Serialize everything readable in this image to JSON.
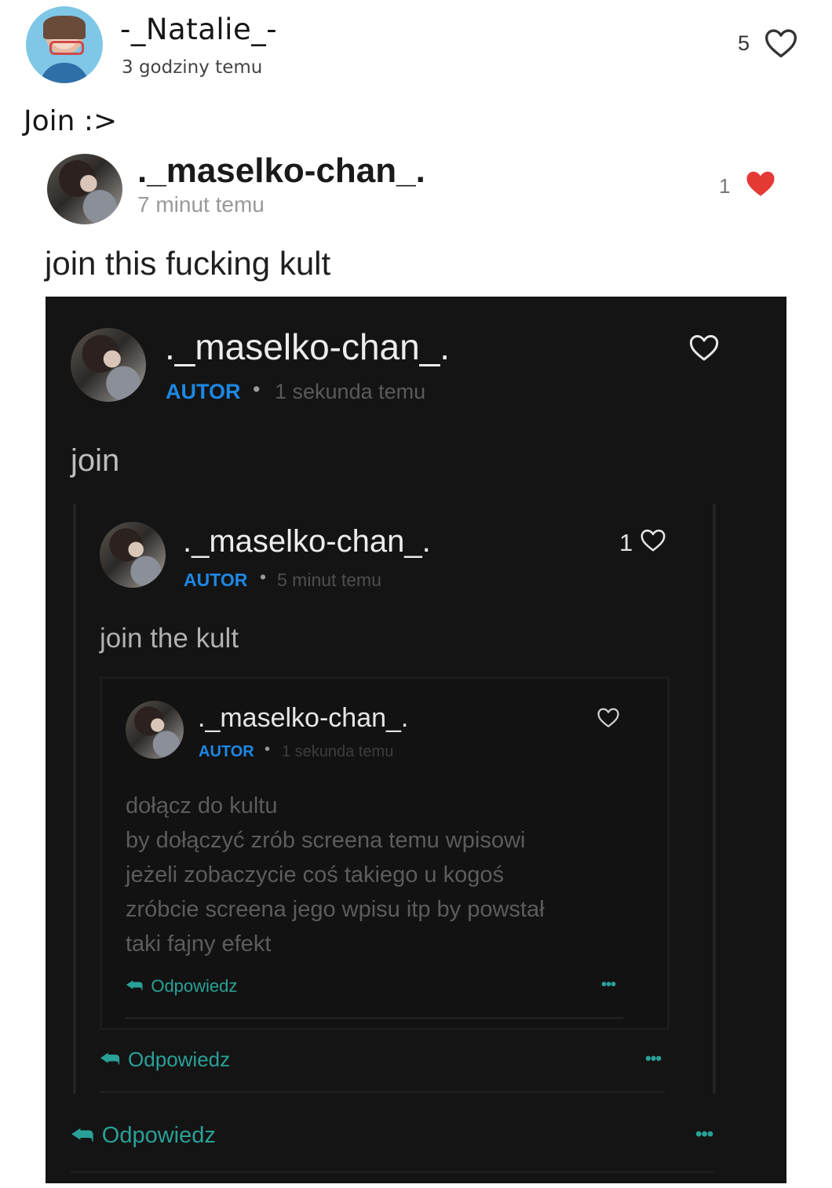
{
  "post": {
    "username": "-_Natalie_-",
    "time": "3 godziny temu",
    "likes": "5",
    "text": "Join :>"
  },
  "reply": {
    "username": "._maselko-chan_.",
    "time": "7 minut temu",
    "likes": "1",
    "text": "join this fucking kult"
  },
  "screenshot": {
    "level1": {
      "username": "._maselko-chan_.",
      "badge": "AUTOR",
      "separator": "•",
      "time": "1 sekunda temu",
      "text": "join",
      "reply_label": "Odpowiedz",
      "more": "•••"
    },
    "level2": {
      "username": "._maselko-chan_.",
      "badge": "AUTOR",
      "separator": "•",
      "time": "5 minut temu",
      "likes": "1",
      "text": "join the kult",
      "reply_label": "Odpowiedz",
      "more": "•••"
    },
    "level3": {
      "username": "._maselko-chan_.",
      "badge": "AUTOR",
      "separator": "•",
      "time": "1 sekunda temu",
      "lines": [
        "dołącz do kultu",
        "by dołączyć zrób screena temu wpisowi",
        "jeżeli zobaczycie coś takiego u kogoś",
        "zróbcie screena jego wpisu itp by powstał",
        "taki fajny efekt"
      ],
      "reply_label": "Odpowiedz",
      "more": "•••"
    }
  },
  "colors": {
    "liked_heart": "#e53935",
    "autor_badge": "#1e88e5",
    "reply_accent": "#2aa198"
  },
  "icons": [
    "heart-outline-icon",
    "heart-filled-icon",
    "reply-arrow-icon",
    "more-dots-icon"
  ]
}
